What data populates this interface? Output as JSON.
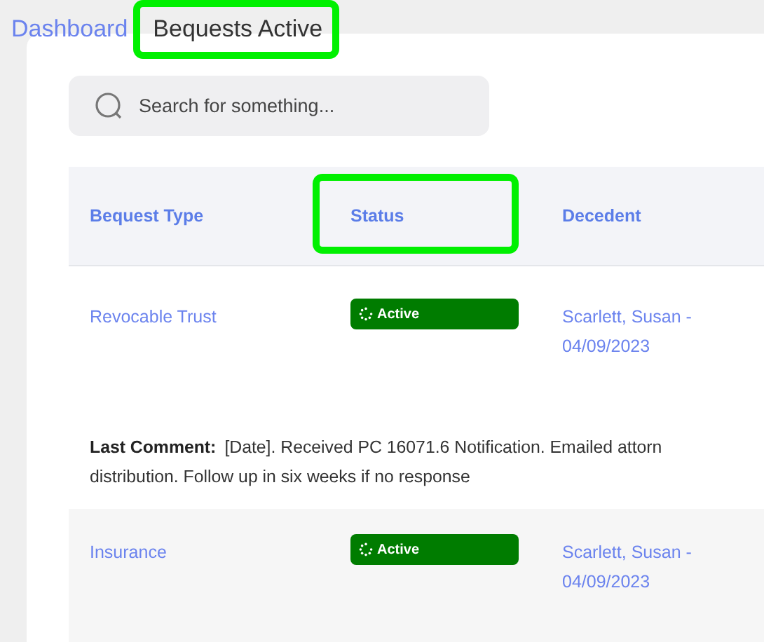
{
  "breadcrumb": {
    "items": [
      {
        "label": "Dashboard",
        "current": false,
        "highlighted": false
      },
      {
        "label": "Bequests Active",
        "current": true,
        "highlighted": true
      }
    ]
  },
  "search": {
    "placeholder": "Search for something..."
  },
  "table": {
    "columns": [
      {
        "label": "Bequest Type",
        "highlighted": false
      },
      {
        "label": "Status",
        "highlighted": true
      },
      {
        "label": "Decedent",
        "highlighted": false
      }
    ],
    "rows": [
      {
        "bequest_type": "Revocable Trust",
        "status": "Active",
        "decedent": "Scarlett, Susan - 04/09/2023",
        "comment_label": "Last Comment:",
        "comment_lines": [
          "[Date]. Received PC 16071.6 Notification. Emailed attorn",
          "distribution. Follow up in six weeks if no response"
        ]
      },
      {
        "bequest_type": "Insurance",
        "status": "Active",
        "decedent": "Scarlett, Susan - 04/09/2023"
      }
    ]
  }
}
